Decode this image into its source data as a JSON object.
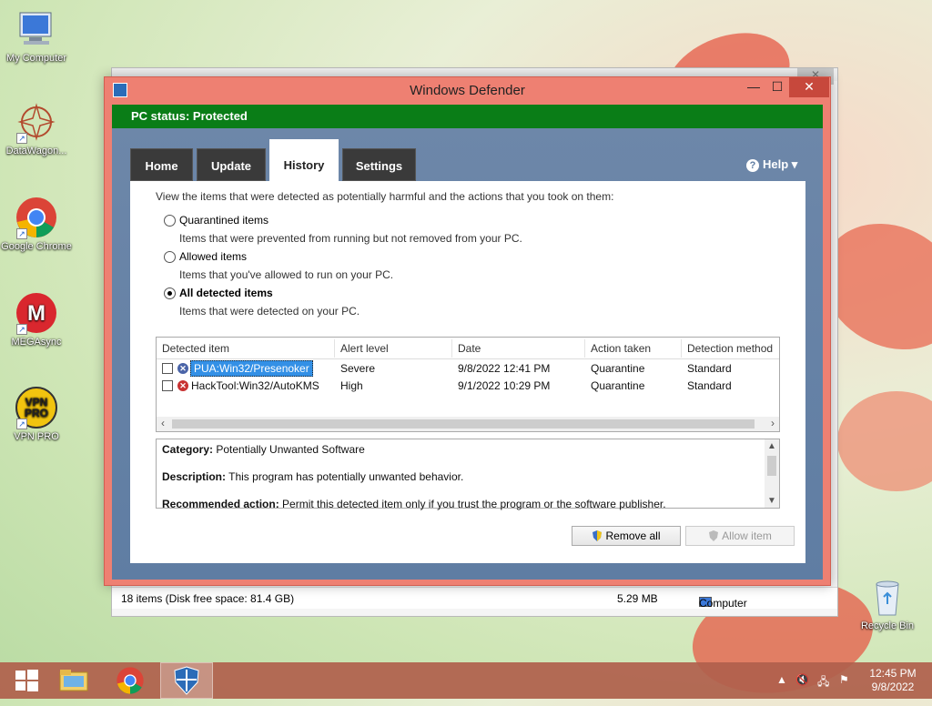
{
  "desktop": {
    "icons": [
      {
        "label": "My Computer"
      },
      {
        "label": "DataWagon..."
      },
      {
        "label": "Google Chrome"
      },
      {
        "label": "MEGAsync"
      },
      {
        "label": "VPN PRO"
      },
      {
        "label": "Recycle Bin"
      }
    ]
  },
  "back_window": {
    "status_items": "18 items (Disk free space: 81.4 GB)",
    "status_size": "5.29 MB",
    "status_location": "Computer"
  },
  "defender": {
    "title": "Windows Defender",
    "window_buttons": {
      "minimize": "—",
      "maximize": "☐",
      "close": "✕"
    },
    "pc_status": "PC status: Protected",
    "status_color": "#0a7d17",
    "tabs": [
      {
        "label": "Home",
        "active": false
      },
      {
        "label": "Update",
        "active": false
      },
      {
        "label": "History",
        "active": true
      },
      {
        "label": "Settings",
        "active": false
      }
    ],
    "help_label": "Help ▾",
    "intro": "View the items that were detected as potentially harmful and the actions that you took on them:",
    "options": [
      {
        "label": "Quarantined items",
        "description": "Items that were prevented from running but not removed from your PC.",
        "checked": false
      },
      {
        "label": "Allowed items",
        "description": "Items that you've allowed to run on your PC.",
        "checked": false
      },
      {
        "label": "All detected items",
        "description": "Items that were detected on your PC.",
        "checked": true
      }
    ],
    "columns": [
      "Detected item",
      "Alert level",
      "Date",
      "Action taken",
      "Detection method"
    ],
    "rows": [
      {
        "name": "PUA:Win32/Presenoker",
        "alert": "Severe",
        "date": "9/8/2022 12:41 PM",
        "action": "Quarantine",
        "method": "Standard",
        "selected": true,
        "icon_color": "#4a64a8"
      },
      {
        "name": "HackTool:Win32/AutoKMS",
        "alert": "High",
        "date": "9/1/2022 10:29 PM",
        "action": "Quarantine",
        "method": "Standard",
        "selected": false,
        "icon_color": "#c83232"
      }
    ],
    "details": {
      "category_label": "Category:",
      "category_value": "Potentially Unwanted Software",
      "description_label": "Description:",
      "description_value": "This program has potentially unwanted behavior.",
      "recommended_label": "Recommended action:",
      "recommended_value": "Permit this detected item only if you trust the program or the software publisher."
    },
    "buttons": {
      "remove_all": "Remove all",
      "allow_item": "Allow item"
    }
  },
  "taskbar": {
    "clock_time": "12:45 PM",
    "clock_date": "9/8/2022",
    "tray_icons": [
      "up-arrow",
      "speaker-muted",
      "network",
      "flag-alert"
    ]
  }
}
